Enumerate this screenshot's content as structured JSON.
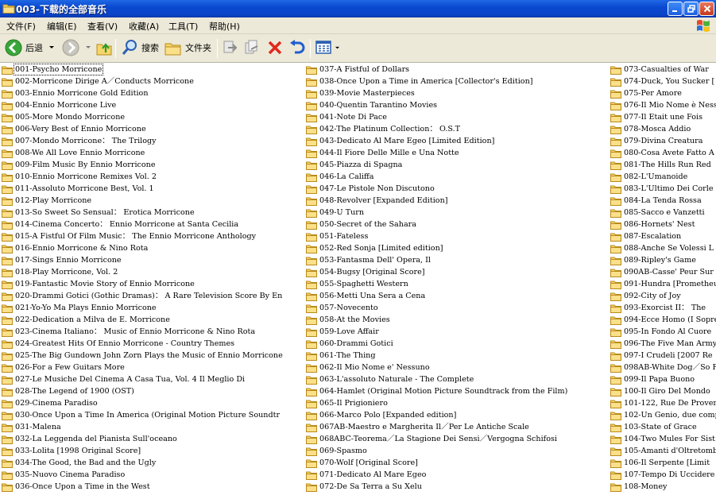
{
  "window": {
    "title": "003-下载的全部音乐"
  },
  "menu": [
    {
      "label": "文件(F)"
    },
    {
      "label": "编辑(E)"
    },
    {
      "label": "查看(V)"
    },
    {
      "label": "收藏(A)"
    },
    {
      "label": "工具(T)"
    },
    {
      "label": "帮助(H)"
    }
  ],
  "toolbar": {
    "back_label": "后退",
    "search_label": "搜索",
    "folders_label": "文件夹"
  },
  "files": {
    "columns": [
      [
        "001-Psycho Morricone",
        "002-Morricone Dirige A／Conducts Morricone",
        "003-Ennio Morricone Gold Edition",
        "004-Ennio Morricone Live",
        "005-More Mondo Morricone",
        "006-Very Best of Ennio Morricone",
        "007-Mondo Morricone： The Trilogy",
        "008-We All Love Ennio Morricone",
        "009-Film Music By Ennio Morricone",
        "010-Ennio Morricone Remixes Vol. 2",
        "011-Assoluto Morricone Best, Vol. 1",
        "012-Play Morricone",
        "013-So Sweet So Sensual： Erotica Morricone",
        "014-Cinema Concerto： Ennio Morricone at Santa Cecilia",
        "015-A Fistful Of Film Music： The Ennio Morricone Anthology",
        "016-Ennio Morricone & Nino Rota",
        "017-Sings Ennio Morricone",
        "018-Play Morricone, Vol. 2",
        "019-Fantastic Movie Story of Ennio Morricone",
        "020-Drammi Gotici (Gothic Dramas)： A Rare Television Score By En",
        "021-Yo-Yo Ma Plays Ennio Morricone",
        "022-Dedication a Milva de E. Morricone",
        "023-Cinema Italiano： Music of Ennio Morricone & Nino Rota",
        "024-Greatest Hits Of Ennio Morricone - Country Themes",
        "025-The Big Gundown John Zorn Plays the Music of Ennio Morricone",
        "026-For a Few Guitars More",
        "027-Le Musiche Del Cinema A Casa Tua, Vol. 4 Il Meglio Di",
        "028-The Legend of 1900 (OST)",
        "029-Cinema Paradiso",
        "030-Once Upon a Time In America (Original Motion Picture Soundtr",
        "031-Malena",
        "032-La Leggenda del Pianista Sull'oceano",
        "033-Lolita [1998 Original Score]",
        "034-The Good, the Bad and the Ugly",
        "035-Nuovo Cinema Paradiso",
        "036-Once Upon a Time in the West"
      ],
      [
        "037-A Fistful of Dollars",
        "038-Once Upon a Time in America [Collector's Edition]",
        "039-Movie Masterpieces",
        "040-Quentin Tarantino Movies",
        "041-Note Di Pace",
        "042-The Platinum Collection： O.S.T",
        "043-Dedicato Al Mare Egeo [Limited Edition]",
        "044-Il Fiore Delle Mille e Una Notte",
        "045-Piazza di Spagna",
        "046-La Califfa",
        "047-Le Pistole Non Discutono",
        "048-Revolver [Expanded Edition]",
        "049-U Turn",
        "050-Secret of the Sahara",
        "051-Fateless",
        "052-Red Sonja [Limited edition]",
        "053-Fantasma Dell' Opera, Il",
        "054-Bugsy [Original Score]",
        "055-Spaghetti Western",
        "056-Metti Una Sera a Cena",
        "057-Novecento",
        "058-At the Movies",
        "059-Love Affair",
        "060-Drammi Gotici",
        "061-The Thing",
        "062-Il Mio Nome e' Nessuno",
        "063-L'assoluto Naturale - The Complete",
        "064-Hamlet (Original Motion Picture Soundtrack from the Film)",
        "065-Il Prigioniero",
        "066-Marco Polo [Expanded edition]",
        "067AB-Maestro e Margherita Il／Per Le Antiche Scale",
        "068ABC-Teorema／La Stagione Dei Sensi／Vergogna Schifosi",
        "069-Spasmo",
        "070-Wolf [Original Score]",
        "071-Dedicato Al Mare Egeo",
        "072-De Sa Terra a Su Xelu"
      ],
      [
        "073-Casualties of War",
        "074-Duck, You Sucker [",
        "075-Per Amore",
        "076-Il Mio Nome è Ness",
        "077-Il Etait une Fois",
        "078-Mosca Addio",
        "079-Divina Creatura",
        "080-Cosa Avete Fatto A",
        "081-The Hills Run Red",
        "082-L'Umanoide",
        "083-L'Ultimo Dei Corle",
        "084-La Tenda Rossa",
        "085-Sacco e Vanzetti",
        "086-Hornets' Nest",
        "087-Escalation",
        "088-Anche Se Volessi L",
        "089-Ripley's Game",
        "090AB-Casse' Peur Sur",
        "091-Hundra [Prometheus",
        "092-City of Joy",
        "093-Exorcist II： The",
        "094-Ecce Homo (I Sopre",
        "095-In Fondo Al Cuore",
        "096-The Five Man Army",
        "097-I Crudeli [2007 Re",
        "098AB-White Dog／So Fi",
        "099-Il Papa Buono",
        "100-Il Giro Del Mondo",
        "101-122, Rue De Prover",
        "102-Un Genio, due comp",
        "103-State of Grace",
        "104-Two Mules For Sist",
        "105-Amanti d'Oltretomb",
        "106-Il Serpente [Limit",
        "107-Tempo Di Uccidere",
        "108-Money"
      ]
    ]
  }
}
